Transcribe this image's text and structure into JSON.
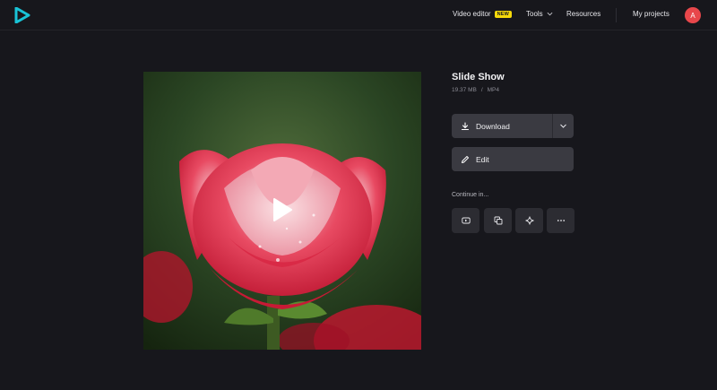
{
  "header": {
    "nav": {
      "video_editor": "Video editor",
      "new_badge": "NEW",
      "tools": "Tools",
      "resources": "Resources",
      "my_projects": "My projects"
    },
    "avatar_initial": "A",
    "icons": {
      "logo": "play-logo-icon",
      "tools_chevron": "chevron-down-icon"
    }
  },
  "media": {
    "title": "Slide Show",
    "size": "19.37 MB",
    "separator": "/",
    "format": "MP4",
    "preview_icon": "play-icon"
  },
  "actions": {
    "download_label": "Download",
    "edit_label": "Edit",
    "continue_label": "Continue in...",
    "continue_icons": [
      "youtube-icon",
      "copy-icon",
      "sparkle-icon",
      "more-icon"
    ]
  },
  "colors": {
    "background": "#17171c",
    "button": "#3a3a41",
    "badge": "#f5d90a",
    "avatar": "#e8474b",
    "logo": "#19c3d6"
  }
}
